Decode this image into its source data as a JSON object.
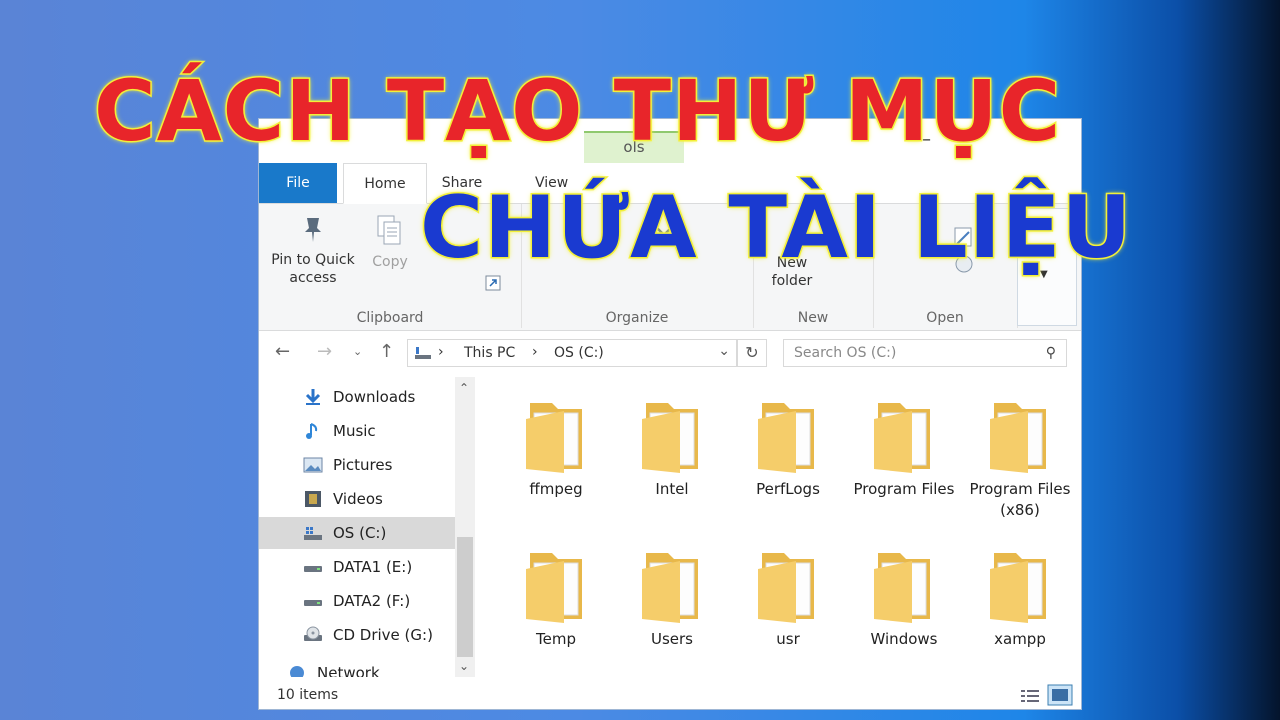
{
  "headline": {
    "line1": "CÁCH TẠO THƯ MỤC",
    "line2": "CHỨA TÀI LIỆU"
  },
  "window": {
    "context_tab": "ols",
    "ribbon_tabs": [
      "File",
      "Home",
      "Share",
      "View"
    ],
    "ribbon_groups": {
      "clipboard": {
        "label": "Clipboard",
        "pin_label": "Pin to Quick access",
        "copy_label": "Copy"
      },
      "organize": {
        "label": "Organize"
      },
      "new": {
        "label": "New",
        "new_folder_label": "New folder"
      },
      "open": {
        "label": "Open"
      }
    },
    "address": {
      "crumbs": [
        "This PC",
        "OS (C:)"
      ]
    },
    "search": {
      "placeholder": "Search OS (C:)"
    },
    "nav_items": [
      {
        "label": "Downloads",
        "icon": "download-arrow-icon"
      },
      {
        "label": "Music",
        "icon": "music-note-icon"
      },
      {
        "label": "Pictures",
        "icon": "picture-icon"
      },
      {
        "label": "Videos",
        "icon": "film-icon"
      },
      {
        "label": "OS (C:)",
        "icon": "windows-drive-icon",
        "selected": true
      },
      {
        "label": "DATA1 (E:)",
        "icon": "drive-icon"
      },
      {
        "label": "DATA2 (F:)",
        "icon": "drive-icon"
      },
      {
        "label": "CD Drive (G:)",
        "icon": "cd-drive-icon"
      },
      {
        "label": "Network",
        "icon": "network-icon"
      }
    ],
    "files": [
      {
        "name": "ffmpeg",
        "icon": "folder-icon"
      },
      {
        "name": "Intel",
        "icon": "folder-icon"
      },
      {
        "name": "PerfLogs",
        "icon": "folder-icon"
      },
      {
        "name": "Program Files",
        "icon": "folder-icon"
      },
      {
        "name": "Program Files (x86)",
        "icon": "folder-icon"
      },
      {
        "name": "Temp",
        "icon": "folder-icon"
      },
      {
        "name": "Users",
        "icon": "folder-icon"
      },
      {
        "name": "usr",
        "icon": "folder-icon"
      },
      {
        "name": "Windows",
        "icon": "folder-icon"
      },
      {
        "name": "xampp",
        "icon": "folder-icon"
      }
    ],
    "status": {
      "item_count": "10 items"
    }
  },
  "colors": {
    "file_tab": "#1979ca",
    "headline_red": "#e8252a",
    "headline_blue": "#1a3ad0",
    "outline_yellow": "#f3f03a",
    "folder": "#f5cd6a"
  }
}
